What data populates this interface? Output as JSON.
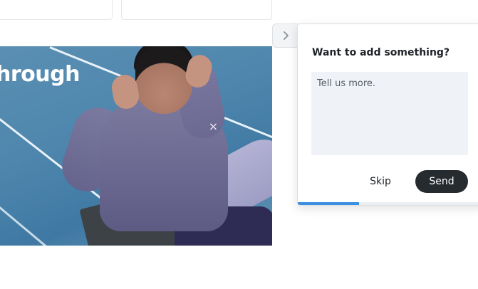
{
  "hero": {
    "headline_visible": "hrough",
    "brand_mark": "⛌"
  },
  "feedback": {
    "collapse_icon": "chevron-right-icon",
    "title": "Want to add something?",
    "placeholder": "Tell us more.",
    "skip_label": "Skip",
    "send_label": "Send",
    "progress": 0.33,
    "accent_color": "#3b8fe0",
    "send_bg": "#262b30"
  }
}
